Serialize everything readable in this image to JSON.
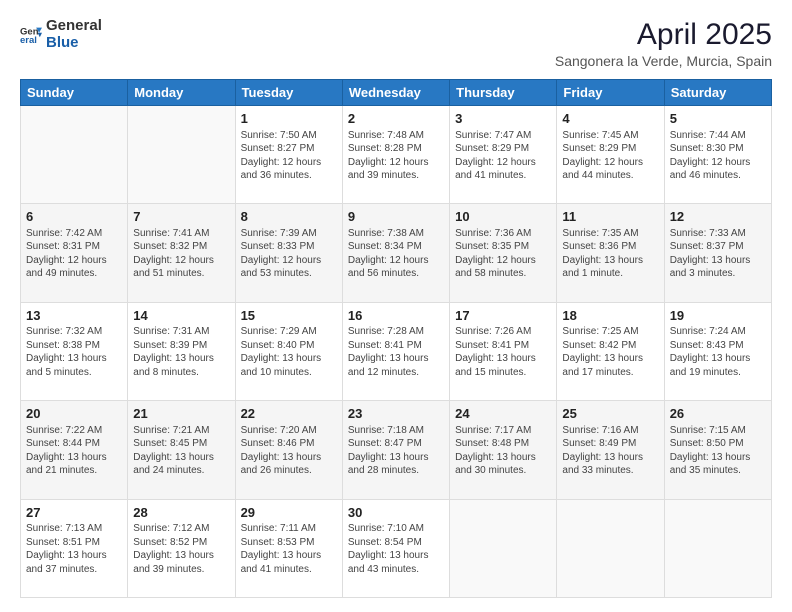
{
  "header": {
    "logo_general": "General",
    "logo_blue": "Blue",
    "title": "April 2025",
    "subtitle": "Sangonera la Verde, Murcia, Spain"
  },
  "days_of_week": [
    "Sunday",
    "Monday",
    "Tuesday",
    "Wednesday",
    "Thursday",
    "Friday",
    "Saturday"
  ],
  "weeks": [
    [
      {
        "day": "",
        "info": ""
      },
      {
        "day": "",
        "info": ""
      },
      {
        "day": "1",
        "info": "Sunrise: 7:50 AM\nSunset: 8:27 PM\nDaylight: 12 hours and 36 minutes."
      },
      {
        "day": "2",
        "info": "Sunrise: 7:48 AM\nSunset: 8:28 PM\nDaylight: 12 hours and 39 minutes."
      },
      {
        "day": "3",
        "info": "Sunrise: 7:47 AM\nSunset: 8:29 PM\nDaylight: 12 hours and 41 minutes."
      },
      {
        "day": "4",
        "info": "Sunrise: 7:45 AM\nSunset: 8:29 PM\nDaylight: 12 hours and 44 minutes."
      },
      {
        "day": "5",
        "info": "Sunrise: 7:44 AM\nSunset: 8:30 PM\nDaylight: 12 hours and 46 minutes."
      }
    ],
    [
      {
        "day": "6",
        "info": "Sunrise: 7:42 AM\nSunset: 8:31 PM\nDaylight: 12 hours and 49 minutes."
      },
      {
        "day": "7",
        "info": "Sunrise: 7:41 AM\nSunset: 8:32 PM\nDaylight: 12 hours and 51 minutes."
      },
      {
        "day": "8",
        "info": "Sunrise: 7:39 AM\nSunset: 8:33 PM\nDaylight: 12 hours and 53 minutes."
      },
      {
        "day": "9",
        "info": "Sunrise: 7:38 AM\nSunset: 8:34 PM\nDaylight: 12 hours and 56 minutes."
      },
      {
        "day": "10",
        "info": "Sunrise: 7:36 AM\nSunset: 8:35 PM\nDaylight: 12 hours and 58 minutes."
      },
      {
        "day": "11",
        "info": "Sunrise: 7:35 AM\nSunset: 8:36 PM\nDaylight: 13 hours and 1 minute."
      },
      {
        "day": "12",
        "info": "Sunrise: 7:33 AM\nSunset: 8:37 PM\nDaylight: 13 hours and 3 minutes."
      }
    ],
    [
      {
        "day": "13",
        "info": "Sunrise: 7:32 AM\nSunset: 8:38 PM\nDaylight: 13 hours and 5 minutes."
      },
      {
        "day": "14",
        "info": "Sunrise: 7:31 AM\nSunset: 8:39 PM\nDaylight: 13 hours and 8 minutes."
      },
      {
        "day": "15",
        "info": "Sunrise: 7:29 AM\nSunset: 8:40 PM\nDaylight: 13 hours and 10 minutes."
      },
      {
        "day": "16",
        "info": "Sunrise: 7:28 AM\nSunset: 8:41 PM\nDaylight: 13 hours and 12 minutes."
      },
      {
        "day": "17",
        "info": "Sunrise: 7:26 AM\nSunset: 8:41 PM\nDaylight: 13 hours and 15 minutes."
      },
      {
        "day": "18",
        "info": "Sunrise: 7:25 AM\nSunset: 8:42 PM\nDaylight: 13 hours and 17 minutes."
      },
      {
        "day": "19",
        "info": "Sunrise: 7:24 AM\nSunset: 8:43 PM\nDaylight: 13 hours and 19 minutes."
      }
    ],
    [
      {
        "day": "20",
        "info": "Sunrise: 7:22 AM\nSunset: 8:44 PM\nDaylight: 13 hours and 21 minutes."
      },
      {
        "day": "21",
        "info": "Sunrise: 7:21 AM\nSunset: 8:45 PM\nDaylight: 13 hours and 24 minutes."
      },
      {
        "day": "22",
        "info": "Sunrise: 7:20 AM\nSunset: 8:46 PM\nDaylight: 13 hours and 26 minutes."
      },
      {
        "day": "23",
        "info": "Sunrise: 7:18 AM\nSunset: 8:47 PM\nDaylight: 13 hours and 28 minutes."
      },
      {
        "day": "24",
        "info": "Sunrise: 7:17 AM\nSunset: 8:48 PM\nDaylight: 13 hours and 30 minutes."
      },
      {
        "day": "25",
        "info": "Sunrise: 7:16 AM\nSunset: 8:49 PM\nDaylight: 13 hours and 33 minutes."
      },
      {
        "day": "26",
        "info": "Sunrise: 7:15 AM\nSunset: 8:50 PM\nDaylight: 13 hours and 35 minutes."
      }
    ],
    [
      {
        "day": "27",
        "info": "Sunrise: 7:13 AM\nSunset: 8:51 PM\nDaylight: 13 hours and 37 minutes."
      },
      {
        "day": "28",
        "info": "Sunrise: 7:12 AM\nSunset: 8:52 PM\nDaylight: 13 hours and 39 minutes."
      },
      {
        "day": "29",
        "info": "Sunrise: 7:11 AM\nSunset: 8:53 PM\nDaylight: 13 hours and 41 minutes."
      },
      {
        "day": "30",
        "info": "Sunrise: 7:10 AM\nSunset: 8:54 PM\nDaylight: 13 hours and 43 minutes."
      },
      {
        "day": "",
        "info": ""
      },
      {
        "day": "",
        "info": ""
      },
      {
        "day": "",
        "info": ""
      }
    ]
  ]
}
